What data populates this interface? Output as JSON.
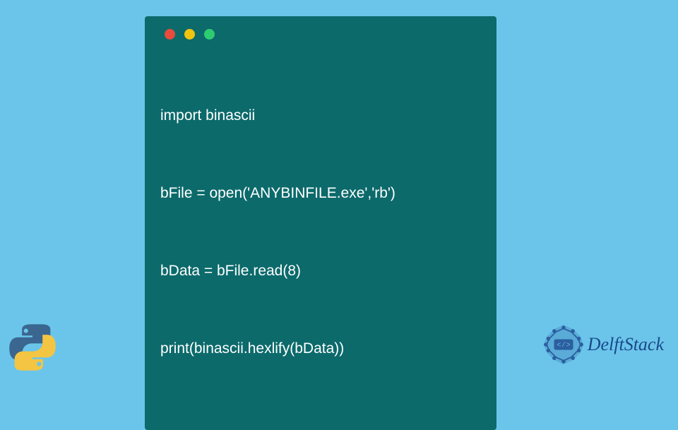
{
  "code": {
    "lines": [
      "import binascii",
      "bFile = open('ANYBINFILE.exe','rb')",
      "bData = bFile.read(8)",
      "print(binascii.hexlify(bData))"
    ]
  },
  "brand": {
    "name": "DelftStack"
  },
  "icons": {
    "python": "python-logo",
    "delftstack_badge": "delftstack-badge"
  },
  "window": {
    "traffic_lights": [
      "red",
      "yellow",
      "green"
    ]
  }
}
